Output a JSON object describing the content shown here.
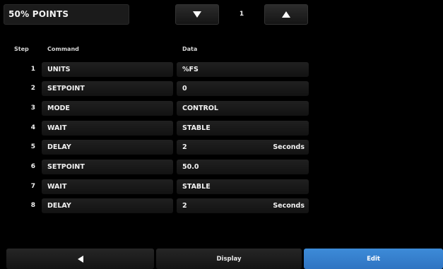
{
  "header": {
    "title": "50% POINTS",
    "page_number": "1",
    "prev_icon": "triangle-down-icon",
    "next_icon": "triangle-up-icon"
  },
  "table": {
    "columns": [
      "Step",
      "Command",
      "Data"
    ],
    "rows": [
      {
        "step": "1",
        "command": "UNITS",
        "data": "%FS",
        "unit": ""
      },
      {
        "step": "2",
        "command": "SETPOINT",
        "data": "0",
        "unit": ""
      },
      {
        "step": "3",
        "command": "MODE",
        "data": "CONTROL",
        "unit": ""
      },
      {
        "step": "4",
        "command": "WAIT",
        "data": "STABLE",
        "unit": ""
      },
      {
        "step": "5",
        "command": "DELAY",
        "data": "2",
        "unit": "Seconds"
      },
      {
        "step": "6",
        "command": "SETPOINT",
        "data": "50.0",
        "unit": ""
      },
      {
        "step": "7",
        "command": "WAIT",
        "data": "STABLE",
        "unit": ""
      },
      {
        "step": "8",
        "command": "DELAY",
        "data": "2",
        "unit": "Seconds"
      }
    ]
  },
  "footer": {
    "back_icon": "triangle-left-icon",
    "display_label": "Display",
    "edit_label": "Edit"
  },
  "colors": {
    "background": "#000000",
    "accent": "#3a86d4",
    "text": "#f2f2f2"
  }
}
